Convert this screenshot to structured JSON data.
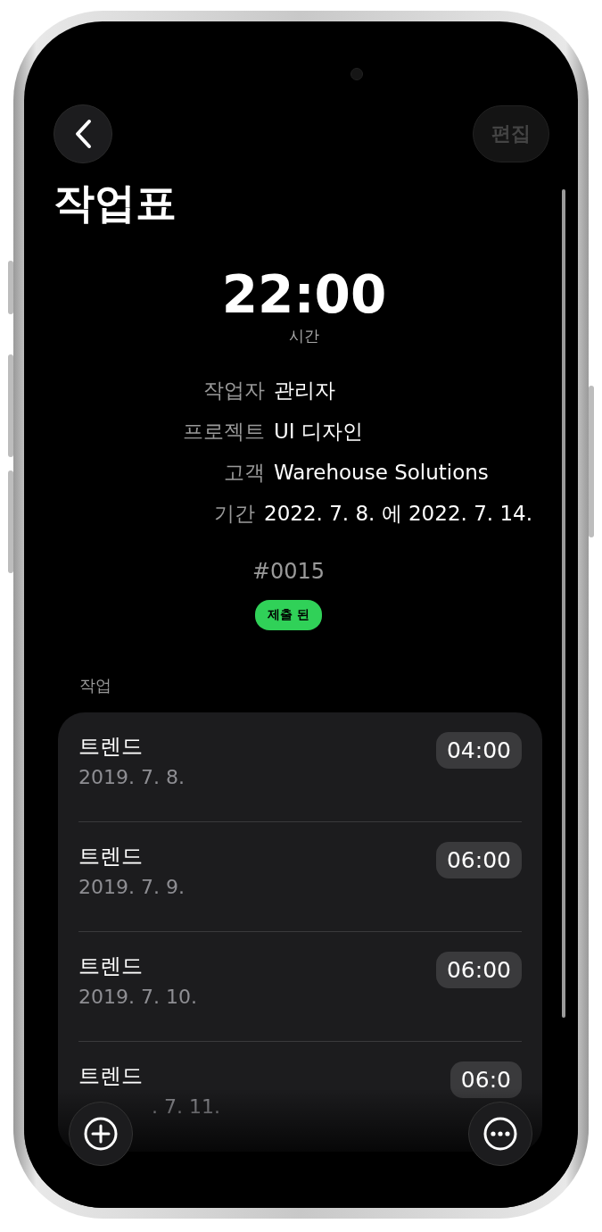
{
  "nav": {
    "edit_button": {
      "label": "편집",
      "disabled": true
    }
  },
  "title": "작업표",
  "total": {
    "value": "22:00",
    "label": "시간"
  },
  "details": [
    {
      "label": "작업자",
      "value": "관리자"
    },
    {
      "label": "프로젝트",
      "value": "UI 디자인"
    },
    {
      "label": "고객",
      "value": "Warehouse Solutions"
    },
    {
      "label": "기간",
      "value": "2022. 7. 8. 에 2022. 7. 14."
    }
  ],
  "number": "#0015",
  "status": {
    "label": "제출 된",
    "color": "#30d158"
  },
  "section_label": "작업",
  "tasks": [
    {
      "name": "트렌드",
      "date": "2019. 7. 8.",
      "duration": "04:00"
    },
    {
      "name": "트렌드",
      "date": "2019. 7. 9.",
      "duration": "06:00"
    },
    {
      "name": "트렌드",
      "date": "2019. 7. 10.",
      "duration": "06:00"
    },
    {
      "name": "트렌드",
      "date": ". 7. 11.",
      "duration": "06:0"
    }
  ]
}
